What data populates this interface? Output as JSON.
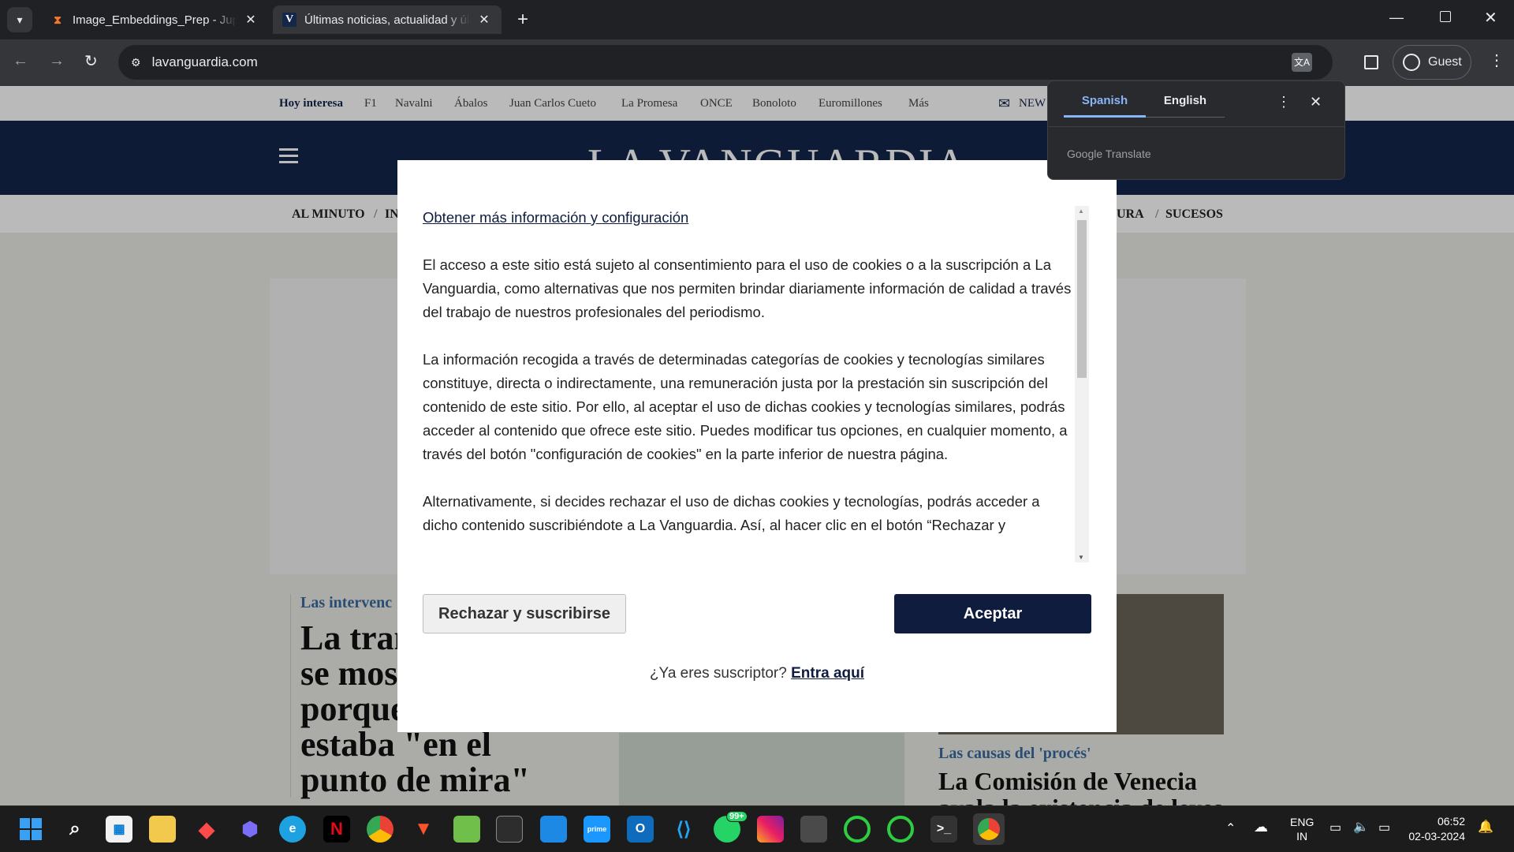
{
  "browser": {
    "tabs": [
      {
        "title": "Image_Embeddings_Prep - Jupyter",
        "favicon": "hourglass-icon",
        "favicon_color": "#f37726"
      },
      {
        "title": "Últimas noticias, actualidad y última hora",
        "favicon": "V",
        "favicon_color": "#14264a"
      }
    ],
    "new_tab_symbol": "+",
    "url": "lavanguardia.com",
    "profile_label": "Guest"
  },
  "site": {
    "hoy_label": "Hoy interesa",
    "trending": [
      "F1",
      "Navalni",
      "Ábalos",
      "Juan Carlos Cueto",
      "La Promesa",
      "ONCE",
      "Bonoloto",
      "Euromillones",
      "Más"
    ],
    "newsletter_label": "NEW",
    "logo": "LA VANGUARDIA",
    "sections_left": [
      "AL MINUTO",
      "IN"
    ],
    "sections_right": [
      "URA",
      "SUCESOS"
    ],
    "article_left": {
      "kicker": "Las intervenc",
      "headline_lines": [
        "La tran",
        "se mos",
        "porque",
        "estaba \"en el",
        "punto de mira\""
      ]
    },
    "article_right": {
      "kicker": "Las causas del 'procés'",
      "headline_lines": [
        "La Comisión de Venecia",
        "avala la existencia de leyes"
      ]
    }
  },
  "modal": {
    "heading_link": "Obtener más información y configuración",
    "paragraphs": [
      "El acceso a este sitio está sujeto al consentimiento para el uso de cookies o a la suscripción a La Vanguardia, como alternativas que nos permiten brindar diariamente información de calidad a través del trabajo de nuestros profesionales del periodismo.",
      "La información recogida a través de determinadas categorías de cookies y tecnologías similares constituye, directa o indirectamente, una remuneración justa por la prestación sin suscripción del contenido de este sitio. Por ello, al aceptar el uso de dichas cookies y tecnologías similares, podrás acceder al contenido que ofrece este sitio. Puedes modificar tus opciones, en cualquier momento, a través del botón \"configuración de cookies\" en la parte inferior de nuestra página.",
      "Alternativamente, si decides rechazar el uso de dichas cookies y tecnologías, podrás acceder a dicho contenido suscribiéndote a La Vanguardia. Así, al hacer clic en el botón “Rechazar y"
    ],
    "reject_label": "Rechazar y suscribirse",
    "accept_label": "Aceptar",
    "subscriber_prompt": "¿Ya eres suscriptor?",
    "subscriber_link": "Entra aquí"
  },
  "translate_popup": {
    "tab_from": "Spanish",
    "tab_to": "English",
    "footer": "Google Translate"
  },
  "taskbar": {
    "lang_top": "ENG",
    "lang_bottom": "IN",
    "time": "06:52",
    "date": "02-03-2024",
    "whatsapp_badge": "99+"
  }
}
